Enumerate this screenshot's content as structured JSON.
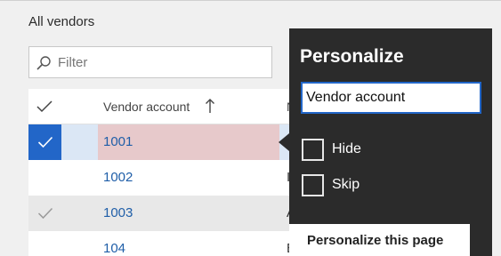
{
  "page": {
    "title": "All vendors"
  },
  "filter": {
    "placeholder": "Filter",
    "icon": "search-icon"
  },
  "grid": {
    "columns": [
      {
        "label": "Vendor account",
        "sort": "ascending"
      }
    ],
    "next_column_partial": "N",
    "rows": [
      {
        "account": "1001",
        "selected": true,
        "marked": true,
        "next_partial": ""
      },
      {
        "account": "1002",
        "selected": false,
        "marked": false,
        "next_partial": "I"
      },
      {
        "account": "1003",
        "selected": false,
        "marked": true,
        "next_partial": "A"
      },
      {
        "account": "104",
        "selected": false,
        "marked": false,
        "next_partial": "E"
      }
    ]
  },
  "personalize": {
    "title": "Personalize",
    "label_value": "Vendor account",
    "hide_label": "Hide",
    "hide_checked": false,
    "skip_label": "Skip",
    "skip_checked": false,
    "personalize_page_label": "Personalize this page"
  },
  "colors": {
    "flyout_bg": "#2b2b2b",
    "accent": "#2266c8",
    "link": "#1f5ea8",
    "selected_cell": "#e7c9cb"
  }
}
